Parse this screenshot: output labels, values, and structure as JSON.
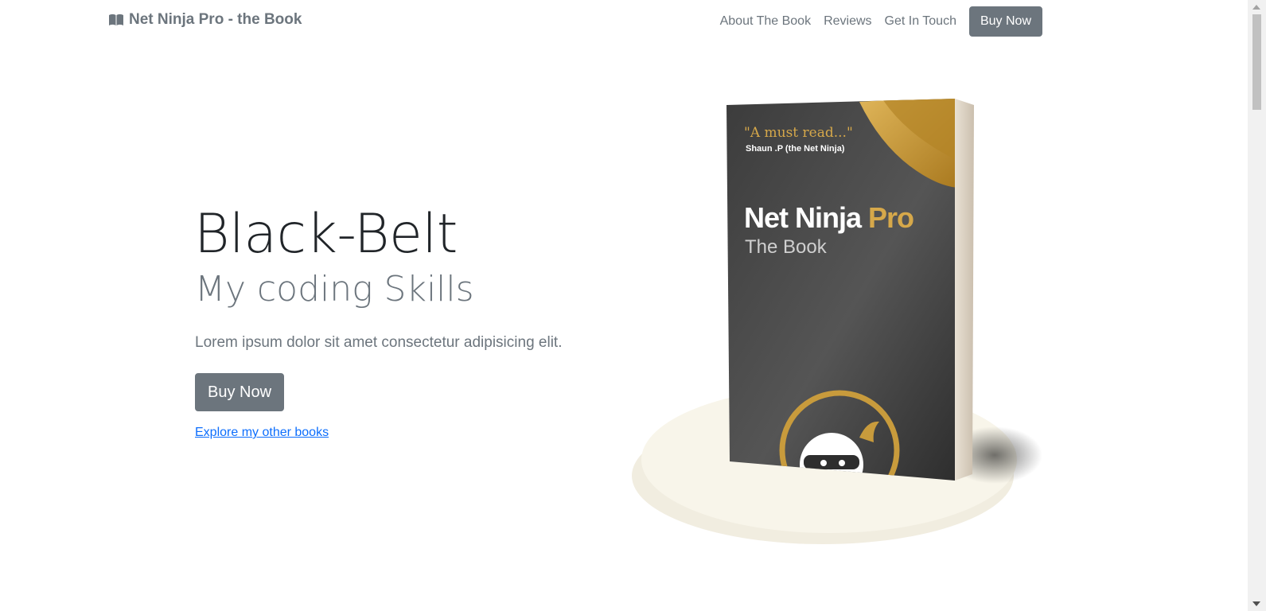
{
  "navbar": {
    "brand_icon": "open-book-icon",
    "brand_text": "Net Ninja Pro - the Book",
    "links": [
      "About The Book",
      "Reviews",
      "Get In Touch"
    ],
    "cta_label": "Buy Now"
  },
  "hero": {
    "title": "Black-Belt",
    "subtitle": "My coding Skills",
    "lead": "Lorem ipsum dolor sit amet consectetur adipisicing elit.",
    "cta_label": "Buy Now",
    "link_text": "Explore my other books"
  },
  "book": {
    "quote": "\"A must read...\"",
    "quote_author": "Shaun .P (the Net Ninja)",
    "title_main": "Net Ninja",
    "title_accent": "Pro",
    "subtitle": "The Book"
  },
  "colors": {
    "secondary": "#6c757d",
    "link": "#0d6efd",
    "gold": "#c89b3c",
    "cover_dark": "#3a3a3a",
    "platform": "#f7f3e8"
  }
}
